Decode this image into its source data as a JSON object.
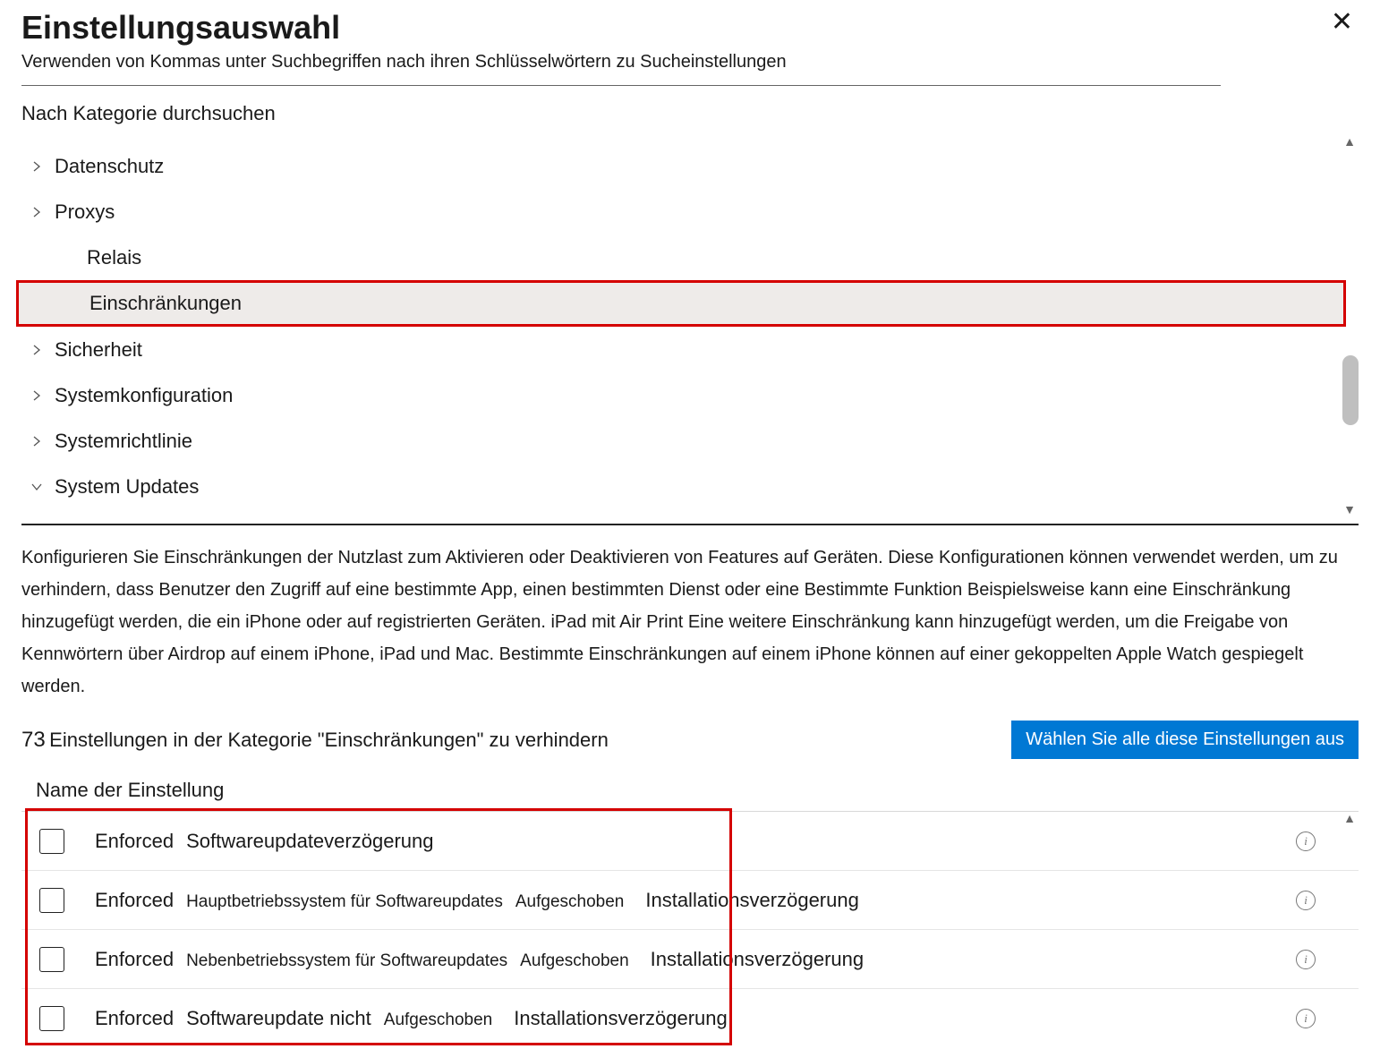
{
  "header": {
    "title": "Einstellungsauswahl",
    "subtitle": "Verwenden von Kommas unter Suchbegriffen nach ihren Schlüsselwörtern zu Sucheinstellungen"
  },
  "browse_label": "Nach Kategorie durchsuchen",
  "categories": [
    {
      "label": "Datenschutz",
      "chev": "right",
      "child": false,
      "hl": false
    },
    {
      "label": "Proxys",
      "chev": "right",
      "child": false,
      "hl": false
    },
    {
      "label": "Relais",
      "chev": "",
      "child": true,
      "hl": false
    },
    {
      "label": "Einschränkungen",
      "chev": "",
      "child": true,
      "hl": true
    },
    {
      "label": "Sicherheit",
      "chev": "right",
      "child": false,
      "hl": false
    },
    {
      "label": "Systemkonfiguration",
      "chev": "right",
      "child": false,
      "hl": false
    },
    {
      "label": "Systemrichtlinie",
      "chev": "right",
      "child": false,
      "hl": false
    },
    {
      "label": "System Updates",
      "chev": "down",
      "child": false,
      "hl": false
    }
  ],
  "description": "Konfigurieren Sie Einschränkungen der Nutzlast zum Aktivieren oder Deaktivieren von Features auf Geräten. Diese Konfigurationen können verwendet werden, um zu verhindern, dass Benutzer den Zugriff auf eine bestimmte App, einen bestimmten Dienst oder eine Bestimmte Funktion Beispielsweise kann eine Einschränkung hinzugefügt werden, die ein iPhone oder auf registrierten Geräten. iPad mit Air Print Eine weitere Einschränkung kann hinzugefügt werden, um die Freigabe von Kennwörtern über Airdrop auf einem iPhone, iPad und Mac. Bestimmte Einschränkungen auf einem iPhone können auf einer gekoppelten Apple Watch gespiegelt werden.",
  "count": {
    "number": "73",
    "text": "Einstellungen in der Kategorie \"Einschränkungen\" zu verhindern"
  },
  "select_all_label": "Wählen Sie alle diese Einstellungen aus",
  "column_header": "Name der Einstellung",
  "settings": [
    {
      "a": "Enforced",
      "b": "Softwareupdateverzögerung",
      "c": "",
      "d": "",
      "e": ""
    },
    {
      "a": "Enforced",
      "b": "",
      "c": "Hauptbetriebssystem für Softwareupdates",
      "d": "Aufgeschoben",
      "e": "Installationsverzögerung"
    },
    {
      "a": "Enforced",
      "b": "",
      "c": "Nebenbetriebssystem für Softwareupdates",
      "d": "Aufgeschoben",
      "e": "Installationsverzögerung"
    },
    {
      "a": "Enforced",
      "b": "Softwareupdate nicht",
      "c": "",
      "d": "Aufgeschoben",
      "e": "Installationsverzögerung"
    }
  ]
}
